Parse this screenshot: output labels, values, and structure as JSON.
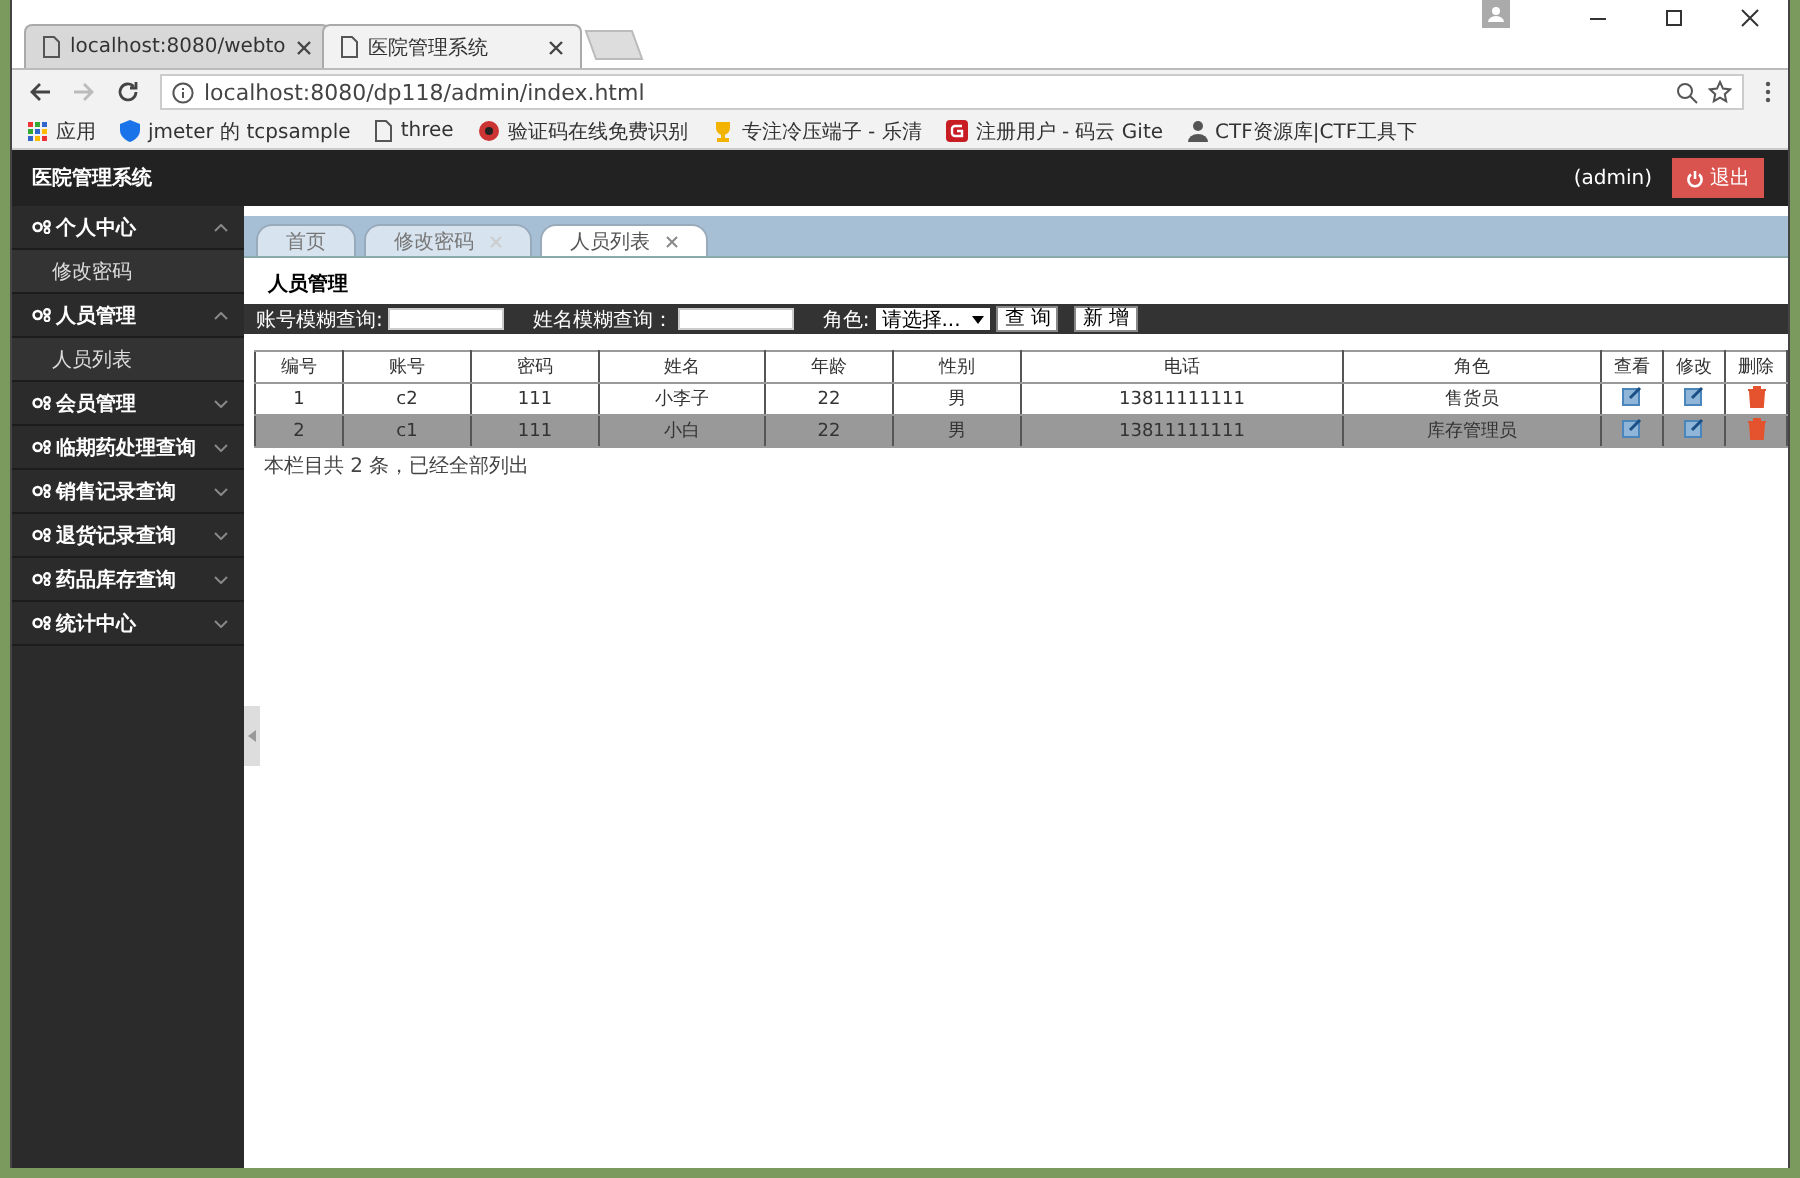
{
  "browser": {
    "tabs": [
      {
        "title": "localhost:8080/webto",
        "selected": false
      },
      {
        "title": "医院管理系统",
        "selected": true
      }
    ],
    "address": "localhost:8080/dp118/admin/index.html",
    "bookmarks": [
      {
        "kind": "apps",
        "label": "应用"
      },
      {
        "kind": "shield",
        "label": "jmeter 的 tcpsample"
      },
      {
        "kind": "page",
        "label": "three"
      },
      {
        "kind": "bug",
        "label": "验证码在线免费识别"
      },
      {
        "kind": "cup",
        "label": "专注冷压端子 - 乐清"
      },
      {
        "kind": "gitee",
        "label": "注册用户 - 码云 Gite"
      },
      {
        "kind": "person",
        "label": "CTF资源库|CTF工具下"
      }
    ]
  },
  "app": {
    "title": "医院管理系统",
    "user": "(admin)",
    "logout": "退出"
  },
  "sidebar": [
    {
      "label": "个人中心",
      "expanded": true,
      "children": [
        {
          "label": "修改密码"
        }
      ]
    },
    {
      "label": "人员管理",
      "expanded": true,
      "children": [
        {
          "label": "人员列表"
        }
      ]
    },
    {
      "label": "会员管理",
      "expanded": false
    },
    {
      "label": "临期药处理查询",
      "expanded": false
    },
    {
      "label": "销售记录查询",
      "expanded": false
    },
    {
      "label": "退货记录查询",
      "expanded": false
    },
    {
      "label": "药品库存查询",
      "expanded": false
    },
    {
      "label": "统计中心",
      "expanded": false
    }
  ],
  "page_tabs": [
    {
      "label": "首页",
      "selected": false,
      "closable": false
    },
    {
      "label": "修改密码",
      "selected": false,
      "closable": true
    },
    {
      "label": "人员列表",
      "selected": true,
      "closable": true
    }
  ],
  "panel_title": "人员管理",
  "search": {
    "account_label": "账号模糊查询:",
    "name_label": "姓名模糊查询：",
    "role_label": "角色:",
    "role_value": "请选择...",
    "query_button": "查 询",
    "add_button": "新 增"
  },
  "table": {
    "columns": [
      "编号",
      "账号",
      "密码",
      "姓名",
      "年龄",
      "性别",
      "电话",
      "角色",
      "查看",
      "修改",
      "删除"
    ],
    "rows": [
      {
        "cells": [
          "1",
          "c2",
          "111",
          "小李子",
          "22",
          "男",
          "13811111111",
          "售货员"
        ],
        "selected": false
      },
      {
        "cells": [
          "2",
          "c1",
          "111",
          "小白",
          "22",
          "男",
          "13811111111",
          "库存管理员"
        ],
        "selected": true
      }
    ]
  },
  "summary": "本栏目共 2 条，已经全部列出"
}
